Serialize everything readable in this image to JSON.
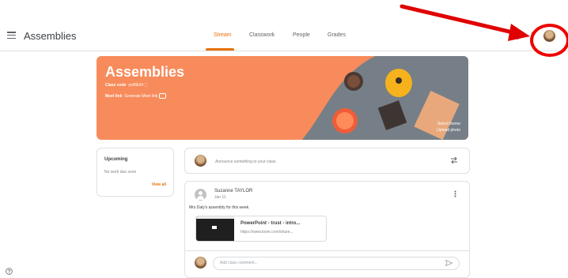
{
  "app": {
    "title": "Assemblies"
  },
  "tabs": [
    {
      "label": "Stream",
      "active": true
    },
    {
      "label": "Classwork",
      "active": false
    },
    {
      "label": "People",
      "active": false
    },
    {
      "label": "Grades",
      "active": false
    }
  ],
  "banner": {
    "title": "Assemblies",
    "class_code_label": "Class code",
    "class_code": "yn36k24",
    "meet_link_label": "Meet link",
    "meet_link_action": "Generate Meet link",
    "select_theme": "Select theme",
    "upload_photo": "Upload photo",
    "color": "#f78b5b"
  },
  "upcoming": {
    "title": "Upcoming",
    "empty_text": "No work due soon",
    "view_all": "View all"
  },
  "announce": {
    "placeholder": "Announce something to your class"
  },
  "post": {
    "author": "Suzanne TAYLOR",
    "date": "Jan 11",
    "body": "Mrs Daly's assembly for this week.",
    "attachment": {
      "title": "PowerPoint - trust - intro...",
      "url": "https://www.loom.com/share..."
    },
    "comment_placeholder": "Add class comment..."
  },
  "colors": {
    "accent": "#e8710a",
    "annotation": "#e00000"
  }
}
